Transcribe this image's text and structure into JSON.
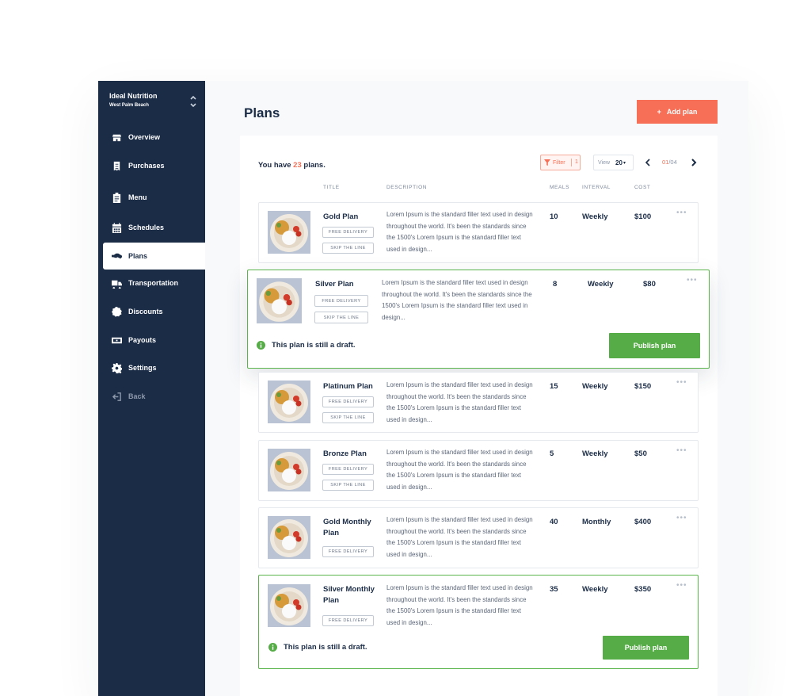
{
  "sidebar": {
    "org_name": "Ideal Nutrition",
    "org_location": "West Palm Beach",
    "items": [
      {
        "label": "Overview",
        "icon": "store-icon"
      },
      {
        "label": "Purchases",
        "icon": "receipt-icon"
      },
      {
        "label": "Menu",
        "icon": "clipboard-icon"
      },
      {
        "label": "Schedules",
        "icon": "calendar-icon"
      },
      {
        "label": "Plans",
        "icon": "handshake-icon",
        "active": true
      },
      {
        "label": "Transportation",
        "icon": "truck-icon"
      },
      {
        "label": "Discounts",
        "icon": "discount-icon"
      },
      {
        "label": "Payouts",
        "icon": "cash-icon"
      },
      {
        "label": "Settings",
        "icon": "gear-icon"
      },
      {
        "label": "Back",
        "icon": "back-icon"
      }
    ]
  },
  "header": {
    "title": "Plans",
    "add_button": "Add plan",
    "add_icon": "+"
  },
  "summary": {
    "prefix": "You have",
    "count": "23",
    "suffix": "plans."
  },
  "toolbar": {
    "filter_label": "Filter",
    "filter_count": "1",
    "view_label": "View",
    "view_value": "20",
    "page_current": "01",
    "page_total": "/04"
  },
  "columns": {
    "title": "TITLE",
    "description": "DESCRIPTION",
    "meals": "MEALS",
    "interval": "INTERVAL",
    "cost": "COST"
  },
  "plans": [
    {
      "title": "Gold Plan",
      "badges": [
        "FREE DELIVERY",
        "SKIP THE LINE"
      ],
      "description": "Lorem Ipsum is the standard filler text used in design throughout the world. It's been the standards since the 1500's Lorem Ipsum is the standard filler text used in design...",
      "meals": "10",
      "interval": "Weekly",
      "cost": "$100"
    },
    {
      "title": "Silver Plan",
      "badges": [
        "FREE DELIVERY",
        "SKIP THE LINE"
      ],
      "description": "Lorem Ipsum is the standard filler text used in design throughout the world. It's been the standards since the 1500's Lorem Ipsum is the standard filler text used in design...",
      "meals": "8",
      "interval": "Weekly",
      "cost": "$80",
      "draft_note": "This plan is still a draft.",
      "publish_label": "Publish plan"
    },
    {
      "title": "Platinum Plan",
      "badges": [
        "FREE DELIVERY",
        "SKIP THE LINE"
      ],
      "description": "Lorem Ipsum is the standard filler text used in design throughout the world. It's been the standards since the 1500's Lorem Ipsum is the standard filler text used in design...",
      "meals": "15",
      "interval": "Weekly",
      "cost": "$150"
    },
    {
      "title": "Bronze Plan",
      "badges": [
        "FREE DELIVERY",
        "SKIP THE LINE"
      ],
      "description": "Lorem Ipsum is the standard filler text used in design throughout the world. It's been the standards since the 1500's Lorem Ipsum is the standard filler text used in design...",
      "meals": "5",
      "interval": "Weekly",
      "cost": "$50"
    },
    {
      "title": "Gold Monthly Plan",
      "badges": [
        "FREE DELIVERY"
      ],
      "description": "Lorem Ipsum is the standard filler text used in design throughout the world. It's been the standards since the 1500's Lorem Ipsum is the standard filler text used in design...",
      "meals": "40",
      "interval": "Monthly",
      "cost": "$400"
    },
    {
      "title": "Silver Monthly Plan",
      "badges": [
        "FREE DELIVERY"
      ],
      "description": "Lorem Ipsum is the standard filler text used in design throughout the world. It's been the standards since the 1500's Lorem Ipsum is the standard filler text used in design...",
      "meals": "35",
      "interval": "Weekly",
      "cost": "$350",
      "draft_note": "This plan is still a draft.",
      "publish_label": "Publish plan"
    }
  ],
  "colors": {
    "sidebar": "#1b2c47",
    "accent": "#f76f56",
    "success": "#56ad47"
  }
}
